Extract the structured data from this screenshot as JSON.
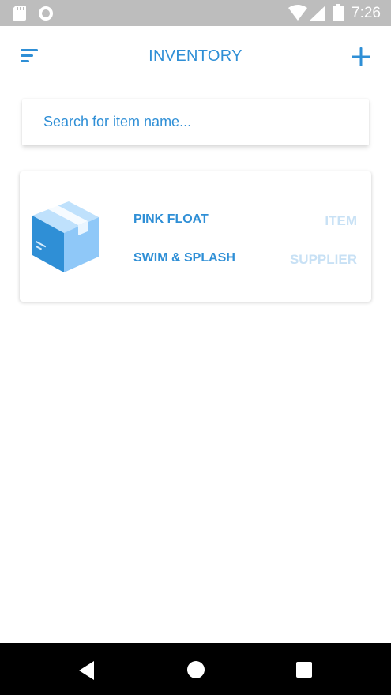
{
  "status_bar": {
    "time": "7:26",
    "icons": [
      "sd-card-icon",
      "circle-icon",
      "wifi-icon",
      "signal-icon",
      "battery-icon"
    ]
  },
  "header": {
    "title": "INVENTORY",
    "menu_icon": "menu-icon",
    "add_icon": "plus-icon"
  },
  "search": {
    "placeholder": "Search for item name...",
    "value": ""
  },
  "items": [
    {
      "icon": "box-icon",
      "name": "PINK FLOAT",
      "supplier": "SWIM & SPLASH",
      "name_label": "ITEM",
      "supplier_label": "SUPPLIER"
    }
  ],
  "nav_bar": {
    "icons": [
      "back-icon",
      "home-icon",
      "recents-icon"
    ]
  },
  "colors": {
    "accent": "#2f8fd6",
    "muted_label": "#c8e1f5",
    "status_bar": "#bdbdbd",
    "nav_bar": "#000000"
  }
}
